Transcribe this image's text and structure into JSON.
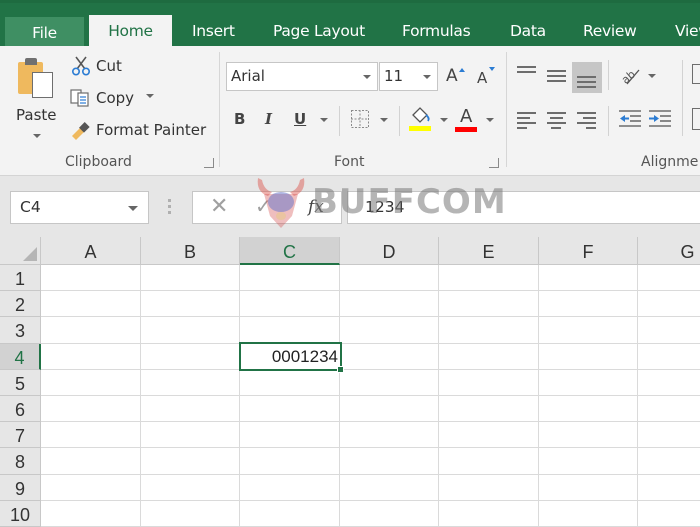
{
  "ribbon_tabs": [
    {
      "label": "File",
      "active": false
    },
    {
      "label": "Home",
      "active": true
    },
    {
      "label": "Insert",
      "active": false
    },
    {
      "label": "Page Layout",
      "active": false
    },
    {
      "label": "Formulas",
      "active": false
    },
    {
      "label": "Data",
      "active": false
    },
    {
      "label": "Review",
      "active": false
    },
    {
      "label": "View",
      "active": false
    }
  ],
  "clipboard": {
    "group_label": "Clipboard",
    "paste_label": "Paste",
    "cut_label": "Cut",
    "copy_label": "Copy",
    "format_painter_label": "Format Painter"
  },
  "font": {
    "group_label": "Font",
    "font_name": "Arial",
    "font_size": "11",
    "grow_label": "A",
    "shrink_label": "A",
    "bold_label": "B",
    "italic_label": "I",
    "underline_label": "U",
    "font_color_label": "A",
    "fill_color": "#ffff00",
    "font_color": "#ff0000"
  },
  "alignment": {
    "group_label": "Alignme"
  },
  "formula_bar": {
    "name_box": "C4",
    "cancel_symbol": "✕",
    "enter_symbol": "✓",
    "fx_label": "fx",
    "formula": "1234"
  },
  "watermark": {
    "text": "BUFFCOM"
  },
  "sheet": {
    "columns": [
      "A",
      "B",
      "C",
      "D",
      "E",
      "F",
      "G"
    ],
    "rows": [
      "1",
      "2",
      "3",
      "4",
      "5",
      "6",
      "7",
      "8",
      "9",
      "10"
    ],
    "selected_column": "C",
    "selected_row": "4",
    "active_cell": {
      "ref": "C4",
      "display_value": "0001234"
    }
  },
  "colors": {
    "accent": "#217346",
    "ribbon_bg": "#f3f3f3",
    "header_bg": "#e6e6e6"
  }
}
